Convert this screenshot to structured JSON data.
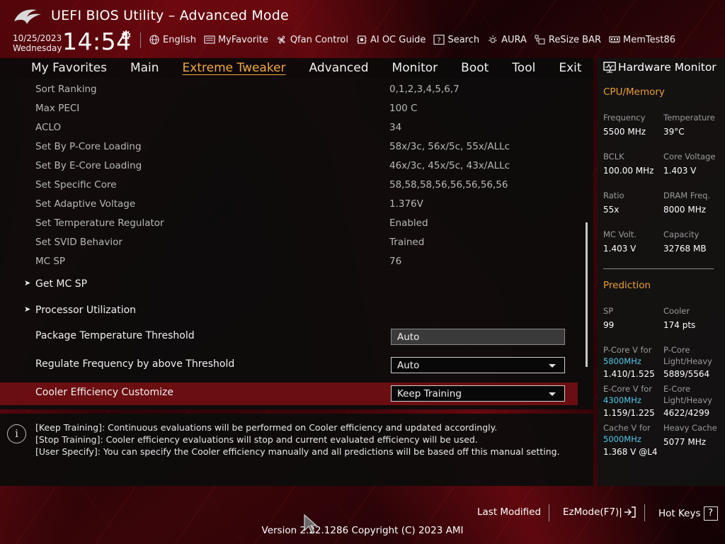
{
  "header": {
    "title": "UEFI BIOS Utility – Advanced Mode",
    "date": "10/25/2023",
    "weekday": "Wednesday",
    "time": "14:54",
    "tools": [
      {
        "label": "English",
        "icon": "globe-icon"
      },
      {
        "label": "MyFavorite",
        "icon": "favorite-icon"
      },
      {
        "label": "Qfan Control",
        "icon": "fan-icon"
      },
      {
        "label": "AI OC Guide",
        "icon": "ai-oc-icon"
      },
      {
        "label": "Search",
        "icon": "search-icon"
      },
      {
        "label": "AURA",
        "icon": "aura-icon"
      },
      {
        "label": "ReSize BAR",
        "icon": "resize-bar-icon"
      },
      {
        "label": "MemTest86",
        "icon": "memtest-icon"
      }
    ]
  },
  "menu": {
    "items": [
      "My Favorites",
      "Main",
      "Extreme Tweaker",
      "Advanced",
      "Monitor",
      "Boot",
      "Tool",
      "Exit"
    ],
    "active": "Extreme Tweaker"
  },
  "info_rows": [
    {
      "label": "Sort Ranking",
      "value": "0,1,2,3,4,5,6,7"
    },
    {
      "label": "Max PECI",
      "value": "100 C"
    },
    {
      "label": "ACLO",
      "value": "34"
    },
    {
      "label": "Set By P-Core Loading",
      "value": "58x/3c, 56x/5c, 55x/ALLc"
    },
    {
      "label": "Set By E-Core Loading",
      "value": "46x/3c, 45x/5c, 43x/ALLc"
    },
    {
      "label": "Set Specific Core",
      "value": "58,58,58,56,56,56,56,56"
    },
    {
      "label": "Set Adaptive Voltage",
      "value": "1.376V"
    },
    {
      "label": "Set Temperature Regulator",
      "value": "Enabled"
    },
    {
      "label": "Set SVID Behavior",
      "value": "Trained"
    },
    {
      "label": "MC SP",
      "value": "76"
    }
  ],
  "submenus": [
    "Get MC SP",
    "Processor Utilization"
  ],
  "settings": [
    {
      "label": "Package Temperature Threshold",
      "value": "Auto"
    },
    {
      "label": "Regulate Frequency by above Threshold",
      "value": "Auto"
    },
    {
      "label": "Cooler Efficiency Customize",
      "value": "Keep Training"
    }
  ],
  "help": {
    "lines": [
      "[Keep Training]: Continuous evaluations will be performed on Cooler efficiency and updated accordingly.",
      "[Stop Training]: Cooler efficiency evaluations will stop and current evaluated efficiency will be used.",
      "[User Specify]: You can specify the Cooler efficiency manually and all predictions will be based off this manual setting."
    ]
  },
  "hw_monitor": {
    "title": "Hardware Monitor",
    "cpu_memory_title": "CPU/Memory",
    "cpu": [
      {
        "key": "Frequency",
        "value": "5500 MHz"
      },
      {
        "key": "Temperature",
        "value": "39°C"
      },
      {
        "key": "BCLK",
        "value": "100.00 MHz"
      },
      {
        "key": "Core Voltage",
        "value": "1.403 V"
      },
      {
        "key": "Ratio",
        "value": "55x"
      },
      {
        "key": "DRAM Freq.",
        "value": "8000 MHz"
      },
      {
        "key": "MC Volt.",
        "value": "1.403 V"
      },
      {
        "key": "Capacity",
        "value": "32768 MB"
      }
    ],
    "prediction_title": "Prediction",
    "sp_key": "SP",
    "sp_value": "99",
    "cooler_key": "Cooler",
    "cooler_value": "174 pts",
    "pcore_v_key": "P-Core V for",
    "pcore_v_freq": "5800MHz",
    "pcore_v_value": "1.410/1.525",
    "pcore_lh_key1": "P-Core",
    "pcore_lh_key2": "Light/Heavy",
    "pcore_lh_value": "5889/5564",
    "ecore_v_key": "E-Core V for",
    "ecore_v_freq": "4300MHz",
    "ecore_v_value": "1.159/1.225",
    "ecore_lh_key1": "E-Core",
    "ecore_lh_key2": "Light/Heavy",
    "ecore_lh_value": "4622/4299",
    "cache_v_key": "Cache V for",
    "cache_v_freq": "5000MHz",
    "cache_v_value": "1.368 V @L4",
    "heavy_cache_key": "Heavy Cache",
    "heavy_cache_value": "5077 MHz"
  },
  "footer": {
    "last_modified": "Last Modified",
    "ezmode": "EzMode(F7)|",
    "hotkeys": "Hot Keys",
    "hotkeys_key": "?",
    "version": "Version 2.22.1286 Copyright (C) 2023 AMI"
  },
  "colors": {
    "accent": "#f0a840",
    "selected_row": "#6b0e12",
    "highlight_freq": "#4fc8e8"
  }
}
